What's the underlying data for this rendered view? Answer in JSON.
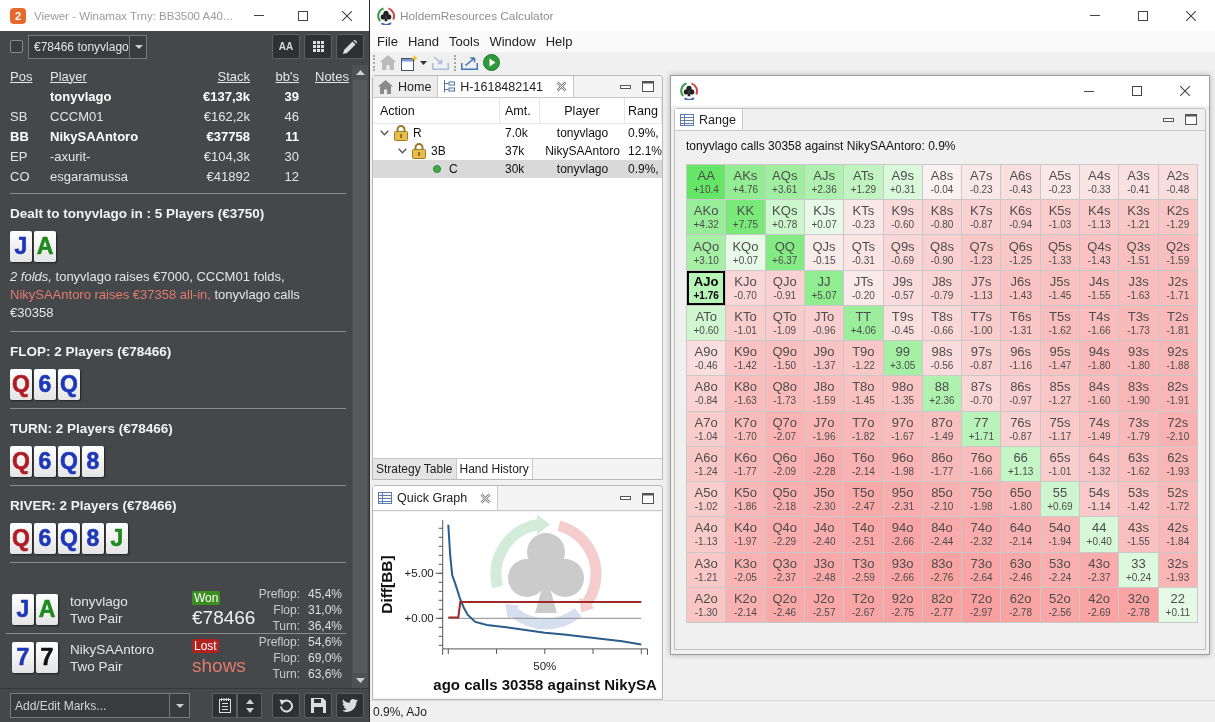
{
  "viewer": {
    "logo": "2",
    "title": "Viewer - Winamax Trny: BB3500 A40...",
    "toolbar": {
      "checked": false,
      "hand_select": "€78466 tonyvlago",
      "font_button": "AA"
    },
    "players": {
      "columns": [
        "Pos",
        "Player",
        "Stack",
        "bb's",
        "Notes"
      ],
      "rows": [
        {
          "player": "tonyvlago",
          "stack": "€137,3k",
          "bbs": "39",
          "highlighted": true
        },
        {
          "pos": "SB",
          "player": "CCCM01",
          "stack": "€162,2k",
          "bbs": "46",
          "highlighted": false
        },
        {
          "pos": "BB",
          "player": "NikySAAntoro",
          "stack": "€37758",
          "bbs": "11",
          "highlighted": true
        },
        {
          "pos": "EP",
          "player": "-axurit-",
          "stack": "€104,3k",
          "bbs": "30",
          "highlighted": false
        },
        {
          "pos": "CO",
          "player": "esgaramussa",
          "stack": "€41892",
          "bbs": "12",
          "highlighted": false
        }
      ]
    },
    "streets": [
      {
        "heading": "Dealt to tonyvlago in : 5 Players (€3750)",
        "cards": [
          {
            "rank": "J",
            "color": "#1c38b8"
          },
          {
            "rank": "A",
            "color": "#1e8a1e"
          }
        ],
        "actions": [
          {
            "kind": "italic",
            "text": "2 folds,"
          },
          {
            "kind": "plain",
            "text": " tonyvlago raises €7000, CCCM01 folds, "
          },
          {
            "kind": "allin",
            "text": "NikySAAntoro raises €37358 all-in,"
          },
          {
            "kind": "plain",
            "text": " tonyvlago calls €30358"
          }
        ]
      },
      {
        "heading": "FLOP: 2 Players (€78466)",
        "cards": [
          {
            "rank": "Q",
            "color": "#b01c24"
          },
          {
            "rank": "6",
            "color": "#1c38b8"
          },
          {
            "rank": "Q",
            "color": "#1c38b8"
          }
        ]
      },
      {
        "heading": "TURN: 2 Players (€78466)",
        "cards": [
          {
            "rank": "Q",
            "color": "#b01c24"
          },
          {
            "rank": "6",
            "color": "#1c38b8"
          },
          {
            "rank": "Q",
            "color": "#1c38b8"
          },
          {
            "rank": "8",
            "color": "#1c38b8"
          }
        ]
      },
      {
        "heading": "RIVER: 2 Players (€78466)",
        "cards": [
          {
            "rank": "Q",
            "color": "#b01c24"
          },
          {
            "rank": "6",
            "color": "#1c38b8"
          },
          {
            "rank": "Q",
            "color": "#1c38b8"
          },
          {
            "rank": "8",
            "color": "#1c38b8"
          },
          {
            "rank": "J",
            "color": "#1e8a1e"
          }
        ]
      }
    ],
    "showdown": [
      {
        "cards": [
          {
            "rank": "J",
            "color": "#1c38b8"
          },
          {
            "rank": "A",
            "color": "#1e8a1e"
          }
        ],
        "player": "tonyvlago",
        "hand": "Two Pair",
        "won": true,
        "result": "Won",
        "amount": "€78466",
        "equity": [
          {
            "street": "Preflop:",
            "value": "45,4%"
          },
          {
            "street": "Flop:",
            "value": "31,0%"
          },
          {
            "street": "Turn:",
            "value": "36,4%"
          }
        ]
      },
      {
        "cards": [
          {
            "rank": "7",
            "color": "#1c38b8"
          },
          {
            "rank": "7",
            "color": "#111111"
          }
        ],
        "player": "NikySAAntoro",
        "hand": "Two Pair",
        "won": false,
        "result": "Lost",
        "amount": "shows",
        "equity": [
          {
            "street": "Preflop:",
            "value": "54,6%"
          },
          {
            "street": "Flop:",
            "value": "69,0%"
          },
          {
            "street": "Turn:",
            "value": "63,6%"
          }
        ]
      }
    ],
    "marks": {
      "placeholder": "Add/Edit Marks..."
    }
  },
  "calculator": {
    "title": "HoldemResources Calculator",
    "menu": [
      "File",
      "Hand",
      "Tools",
      "Window",
      "Help"
    ],
    "toolbar": [
      {
        "items": [
          {
            "kind": "home",
            "disabled": true
          },
          {
            "kind": "new",
            "disabled": false
          },
          {
            "kind": "import",
            "disabled": true
          }
        ]
      },
      {
        "items": [
          {
            "kind": "export",
            "disabled": false
          },
          {
            "kind": "run",
            "disabled": false
          }
        ]
      }
    ],
    "hand_view": {
      "tabs": [
        {
          "kind": "home",
          "label": "Home",
          "selected": false,
          "closable": false
        },
        {
          "kind": "hand",
          "label": "H-1618482141",
          "selected": true,
          "closable": true
        }
      ],
      "tree": {
        "columns": [
          "Action",
          "Amt.",
          "Player",
          "Rang"
        ],
        "rows": [
          {
            "kind": "lock",
            "action": "R",
            "amount": "7.0k",
            "player": "tonyvlago",
            "column_4": "0.9%,",
            "expanded": true,
            "selected": false,
            "children": [
              {
                "kind": "lock",
                "action": "3B",
                "amount": "37k",
                "player": "NikySAAntoro",
                "column_4": "12.1%",
                "expanded": true,
                "selected": false,
                "children": [
                  {
                    "kind": "dot",
                    "action": "C",
                    "amount": "30k",
                    "player": "tonyvlago",
                    "column_4": "0.9%,",
                    "selected": true
                  }
                ]
              }
            ]
          }
        ]
      },
      "bottom_tabs": [
        {
          "label": "Strategy Table",
          "selected": false
        },
        {
          "label": "Hand History",
          "selected": true
        }
      ]
    },
    "quick_graph": {
      "tab": "Quick Graph",
      "graph": {
        "title": "ago calls 30358 against NikySA",
        "ylabel": "Diff[BB]",
        "yticks": [
          "+5.00",
          "+0.00"
        ],
        "xticks": [
          "50%"
        ]
      }
    },
    "status_bar": "0.9%, AJo",
    "range_window": {
      "tab": "Range",
      "caption": "tonyvlago calls 30358 against NikySAAntoro: 0.9%",
      "grid": [
        {
          "cells": [
            {
              "hand": "AA",
              "ev": "+10.4",
              "selected": false
            },
            {
              "hand": "AKs",
              "ev": "+4.76",
              "selected": false
            },
            {
              "hand": "AQs",
              "ev": "+3.61",
              "selected": false
            },
            {
              "hand": "AJs",
              "ev": "+2.36",
              "selected": false
            },
            {
              "hand": "ATs",
              "ev": "+1.29",
              "selected": false
            },
            {
              "hand": "A9s",
              "ev": "+0.31",
              "selected": false
            },
            {
              "hand": "A8s",
              "ev": "-0.04",
              "selected": false
            },
            {
              "hand": "A7s",
              "ev": "-0.23",
              "selected": false
            },
            {
              "hand": "A6s",
              "ev": "-0.43",
              "selected": false
            },
            {
              "hand": "A5s",
              "ev": "-0.23",
              "selected": false
            },
            {
              "hand": "A4s",
              "ev": "-0.33",
              "selected": false
            },
            {
              "hand": "A3s",
              "ev": "-0.41",
              "selected": false
            },
            {
              "hand": "A2s",
              "ev": "-0.48",
              "selected": false
            }
          ]
        },
        {
          "cells": [
            {
              "hand": "AKo",
              "ev": "+4.32",
              "selected": false
            },
            {
              "hand": "KK",
              "ev": "+7.75",
              "selected": false
            },
            {
              "hand": "KQs",
              "ev": "+0.78",
              "selected": false
            },
            {
              "hand": "KJs",
              "ev": "+0.07",
              "selected": false
            },
            {
              "hand": "KTs",
              "ev": "-0.23",
              "selected": false
            },
            {
              "hand": "K9s",
              "ev": "-0.60",
              "selected": false
            },
            {
              "hand": "K8s",
              "ev": "-0.80",
              "selected": false
            },
            {
              "hand": "K7s",
              "ev": "-0.87",
              "selected": false
            },
            {
              "hand": "K6s",
              "ev": "-0.94",
              "selected": false
            },
            {
              "hand": "K5s",
              "ev": "-1.03",
              "selected": false
            },
            {
              "hand": "K4s",
              "ev": "-1.13",
              "selected": false
            },
            {
              "hand": "K3s",
              "ev": "-1.21",
              "selected": false
            },
            {
              "hand": "K2s",
              "ev": "-1.29",
              "selected": false
            }
          ]
        },
        {
          "cells": [
            {
              "hand": "AQo",
              "ev": "+3.10",
              "selected": false
            },
            {
              "hand": "KQo",
              "ev": "+0.07",
              "selected": false
            },
            {
              "hand": "QQ",
              "ev": "+6.37",
              "selected": false
            },
            {
              "hand": "QJs",
              "ev": "-0.15",
              "selected": false
            },
            {
              "hand": "QTs",
              "ev": "-0.31",
              "selected": false
            },
            {
              "hand": "Q9s",
              "ev": "-0.69",
              "selected": false
            },
            {
              "hand": "Q8s",
              "ev": "-0.90",
              "selected": false
            },
            {
              "hand": "Q7s",
              "ev": "-1.23",
              "selected": false
            },
            {
              "hand": "Q6s",
              "ev": "-1.25",
              "selected": false
            },
            {
              "hand": "Q5s",
              "ev": "-1.33",
              "selected": false
            },
            {
              "hand": "Q4s",
              "ev": "-1.43",
              "selected": false
            },
            {
              "hand": "Q3s",
              "ev": "-1.51",
              "selected": false
            },
            {
              "hand": "Q2s",
              "ev": "-1.59",
              "selected": false
            }
          ]
        },
        {
          "cells": [
            {
              "hand": "AJo",
              "ev": "+1.76",
              "selected": true
            },
            {
              "hand": "KJo",
              "ev": "-0.70",
              "selected": false
            },
            {
              "hand": "QJo",
              "ev": "-0.91",
              "selected": false
            },
            {
              "hand": "JJ",
              "ev": "+5.07",
              "selected": false
            },
            {
              "hand": "JTs",
              "ev": "-0.20",
              "selected": false
            },
            {
              "hand": "J9s",
              "ev": "-0.57",
              "selected": false
            },
            {
              "hand": "J8s",
              "ev": "-0.79",
              "selected": false
            },
            {
              "hand": "J7s",
              "ev": "-1.13",
              "selected": false
            },
            {
              "hand": "J6s",
              "ev": "-1.43",
              "selected": false
            },
            {
              "hand": "J5s",
              "ev": "-1.45",
              "selected": false
            },
            {
              "hand": "J4s",
              "ev": "-1.55",
              "selected": false
            },
            {
              "hand": "J3s",
              "ev": "-1.63",
              "selected": false
            },
            {
              "hand": "J2s",
              "ev": "-1.71",
              "selected": false
            }
          ]
        },
        {
          "cells": [
            {
              "hand": "ATo",
              "ev": "+0.60",
              "selected": false
            },
            {
              "hand": "KTo",
              "ev": "-1.01",
              "selected": false
            },
            {
              "hand": "QTo",
              "ev": "-1.09",
              "selected": false
            },
            {
              "hand": "JTo",
              "ev": "-0.96",
              "selected": false
            },
            {
              "hand": "TT",
              "ev": "+4.06",
              "selected": false
            },
            {
              "hand": "T9s",
              "ev": "-0.45",
              "selected": false
            },
            {
              "hand": "T8s",
              "ev": "-0.66",
              "selected": false
            },
            {
              "hand": "T7s",
              "ev": "-1.00",
              "selected": false
            },
            {
              "hand": "T6s",
              "ev": "-1.31",
              "selected": false
            },
            {
              "hand": "T5s",
              "ev": "-1.62",
              "selected": false
            },
            {
              "hand": "T4s",
              "ev": "-1.66",
              "selected": false
            },
            {
              "hand": "T3s",
              "ev": "-1.73",
              "selected": false
            },
            {
              "hand": "T2s",
              "ev": "-1.81",
              "selected": false
            }
          ]
        },
        {
          "cells": [
            {
              "hand": "A9o",
              "ev": "-0.46",
              "selected": false
            },
            {
              "hand": "K9o",
              "ev": "-1.42",
              "selected": false
            },
            {
              "hand": "Q9o",
              "ev": "-1.50",
              "selected": false
            },
            {
              "hand": "J9o",
              "ev": "-1.37",
              "selected": false
            },
            {
              "hand": "T9o",
              "ev": "-1.22",
              "selected": false
            },
            {
              "hand": "99",
              "ev": "+3.05",
              "selected": false
            },
            {
              "hand": "98s",
              "ev": "-0.56",
              "selected": false
            },
            {
              "hand": "97s",
              "ev": "-0.87",
              "selected": false
            },
            {
              "hand": "96s",
              "ev": "-1.16",
              "selected": false
            },
            {
              "hand": "95s",
              "ev": "-1.47",
              "selected": false
            },
            {
              "hand": "94s",
              "ev": "-1.80",
              "selected": false
            },
            {
              "hand": "93s",
              "ev": "-1.80",
              "selected": false
            },
            {
              "hand": "92s",
              "ev": "-1.88",
              "selected": false
            }
          ]
        },
        {
          "cells": [
            {
              "hand": "A8o",
              "ev": "-0.84",
              "selected": false
            },
            {
              "hand": "K8o",
              "ev": "-1.63",
              "selected": false
            },
            {
              "hand": "Q8o",
              "ev": "-1.73",
              "selected": false
            },
            {
              "hand": "J8o",
              "ev": "-1.59",
              "selected": false
            },
            {
              "hand": "T8o",
              "ev": "-1.45",
              "selected": false
            },
            {
              "hand": "98o",
              "ev": "-1.35",
              "selected": false
            },
            {
              "hand": "88",
              "ev": "+2.36",
              "selected": false
            },
            {
              "hand": "87s",
              "ev": "-0.70",
              "selected": false
            },
            {
              "hand": "86s",
              "ev": "-0.97",
              "selected": false
            },
            {
              "hand": "85s",
              "ev": "-1.27",
              "selected": false
            },
            {
              "hand": "84s",
              "ev": "-1.60",
              "selected": false
            },
            {
              "hand": "83s",
              "ev": "-1.90",
              "selected": false
            },
            {
              "hand": "82s",
              "ev": "-1.91",
              "selected": false
            }
          ]
        },
        {
          "cells": [
            {
              "hand": "A7o",
              "ev": "-1.04",
              "selected": false
            },
            {
              "hand": "K7o",
              "ev": "-1.70",
              "selected": false
            },
            {
              "hand": "Q7o",
              "ev": "-2.07",
              "selected": false
            },
            {
              "hand": "J7o",
              "ev": "-1.96",
              "selected": false
            },
            {
              "hand": "T7o",
              "ev": "-1.82",
              "selected": false
            },
            {
              "hand": "97o",
              "ev": "-1.67",
              "selected": false
            },
            {
              "hand": "87o",
              "ev": "-1.49",
              "selected": false
            },
            {
              "hand": "77",
              "ev": "+1.71",
              "selected": false
            },
            {
              "hand": "76s",
              "ev": "-0.87",
              "selected": false
            },
            {
              "hand": "75s",
              "ev": "-1.17",
              "selected": false
            },
            {
              "hand": "74s",
              "ev": "-1.49",
              "selected": false
            },
            {
              "hand": "73s",
              "ev": "-1.79",
              "selected": false
            },
            {
              "hand": "72s",
              "ev": "-2.10",
              "selected": false
            }
          ]
        },
        {
          "cells": [
            {
              "hand": "A6o",
              "ev": "-1.24",
              "selected": false
            },
            {
              "hand": "K6o",
              "ev": "-1.77",
              "selected": false
            },
            {
              "hand": "Q6o",
              "ev": "-2.09",
              "selected": false
            },
            {
              "hand": "J6o",
              "ev": "-2.28",
              "selected": false
            },
            {
              "hand": "T6o",
              "ev": "-2.14",
              "selected": false
            },
            {
              "hand": "96o",
              "ev": "-1.98",
              "selected": false
            },
            {
              "hand": "86o",
              "ev": "-1.77",
              "selected": false
            },
            {
              "hand": "76o",
              "ev": "-1.66",
              "selected": false
            },
            {
              "hand": "66",
              "ev": "+1.13",
              "selected": false
            },
            {
              "hand": "65s",
              "ev": "-1.01",
              "selected": false
            },
            {
              "hand": "64s",
              "ev": "-1.32",
              "selected": false
            },
            {
              "hand": "63s",
              "ev": "-1.62",
              "selected": false
            },
            {
              "hand": "62s",
              "ev": "-1.93",
              "selected": false
            }
          ]
        },
        {
          "cells": [
            {
              "hand": "A5o",
              "ev": "-1.02",
              "selected": false
            },
            {
              "hand": "K5o",
              "ev": "-1.86",
              "selected": false
            },
            {
              "hand": "Q5o",
              "ev": "-2.18",
              "selected": false
            },
            {
              "hand": "J5o",
              "ev": "-2.30",
              "selected": false
            },
            {
              "hand": "T5o",
              "ev": "-2.47",
              "selected": false
            },
            {
              "hand": "95o",
              "ev": "-2.31",
              "selected": false
            },
            {
              "hand": "85o",
              "ev": "-2.10",
              "selected": false
            },
            {
              "hand": "75o",
              "ev": "-1.98",
              "selected": false
            },
            {
              "hand": "65o",
              "ev": "-1.80",
              "selected": false
            },
            {
              "hand": "55",
              "ev": "+0.69",
              "selected": false
            },
            {
              "hand": "54s",
              "ev": "-1.14",
              "selected": false
            },
            {
              "hand": "53s",
              "ev": "-1.42",
              "selected": false
            },
            {
              "hand": "52s",
              "ev": "-1.72",
              "selected": false
            }
          ]
        },
        {
          "cells": [
            {
              "hand": "A4o",
              "ev": "-1.13",
              "selected": false
            },
            {
              "hand": "K4o",
              "ev": "-1.97",
              "selected": false
            },
            {
              "hand": "Q4o",
              "ev": "-2.29",
              "selected": false
            },
            {
              "hand": "J4o",
              "ev": "-2.40",
              "selected": false
            },
            {
              "hand": "T4o",
              "ev": "-2.51",
              "selected": false
            },
            {
              "hand": "94o",
              "ev": "-2.66",
              "selected": false
            },
            {
              "hand": "84o",
              "ev": "-2.44",
              "selected": false
            },
            {
              "hand": "74o",
              "ev": "-2.32",
              "selected": false
            },
            {
              "hand": "64o",
              "ev": "-2.14",
              "selected": false
            },
            {
              "hand": "54o",
              "ev": "-1.94",
              "selected": false
            },
            {
              "hand": "44",
              "ev": "+0.40",
              "selected": false
            },
            {
              "hand": "43s",
              "ev": "-1.55",
              "selected": false
            },
            {
              "hand": "42s",
              "ev": "-1.84",
              "selected": false
            }
          ]
        },
        {
          "cells": [
            {
              "hand": "A3o",
              "ev": "-1.21",
              "selected": false
            },
            {
              "hand": "K3o",
              "ev": "-2.05",
              "selected": false
            },
            {
              "hand": "Q3o",
              "ev": "-2.37",
              "selected": false
            },
            {
              "hand": "J3o",
              "ev": "-2.48",
              "selected": false
            },
            {
              "hand": "T3o",
              "ev": "-2.59",
              "selected": false
            },
            {
              "hand": "93o",
              "ev": "-2.66",
              "selected": false
            },
            {
              "hand": "83o",
              "ev": "-2.76",
              "selected": false
            },
            {
              "hand": "73o",
              "ev": "-2.64",
              "selected": false
            },
            {
              "hand": "63o",
              "ev": "-2.46",
              "selected": false
            },
            {
              "hand": "53o",
              "ev": "-2.24",
              "selected": false
            },
            {
              "hand": "43o",
              "ev": "-2.37",
              "selected": false
            },
            {
              "hand": "33",
              "ev": "+0.24",
              "selected": false
            },
            {
              "hand": "32s",
              "ev": "-1.93",
              "selected": false
            }
          ]
        },
        {
          "cells": [
            {
              "hand": "A2o",
              "ev": "-1.30",
              "selected": false
            },
            {
              "hand": "K2o",
              "ev": "-2.14",
              "selected": false
            },
            {
              "hand": "Q2o",
              "ev": "-2.46",
              "selected": false
            },
            {
              "hand": "J2o",
              "ev": "-2.57",
              "selected": false
            },
            {
              "hand": "T2o",
              "ev": "-2.67",
              "selected": false
            },
            {
              "hand": "92o",
              "ev": "-2.75",
              "selected": false
            },
            {
              "hand": "82o",
              "ev": "-2.77",
              "selected": false
            },
            {
              "hand": "72o",
              "ev": "-2.97",
              "selected": false
            },
            {
              "hand": "62o",
              "ev": "-2.78",
              "selected": false
            },
            {
              "hand": "52o",
              "ev": "-2.56",
              "selected": false
            },
            {
              "hand": "42o",
              "ev": "-2.69",
              "selected": false
            },
            {
              "hand": "32o",
              "ev": "-2.78",
              "selected": false
            },
            {
              "hand": "22",
              "ev": "+0.11",
              "selected": false
            }
          ]
        }
      ]
    }
  }
}
